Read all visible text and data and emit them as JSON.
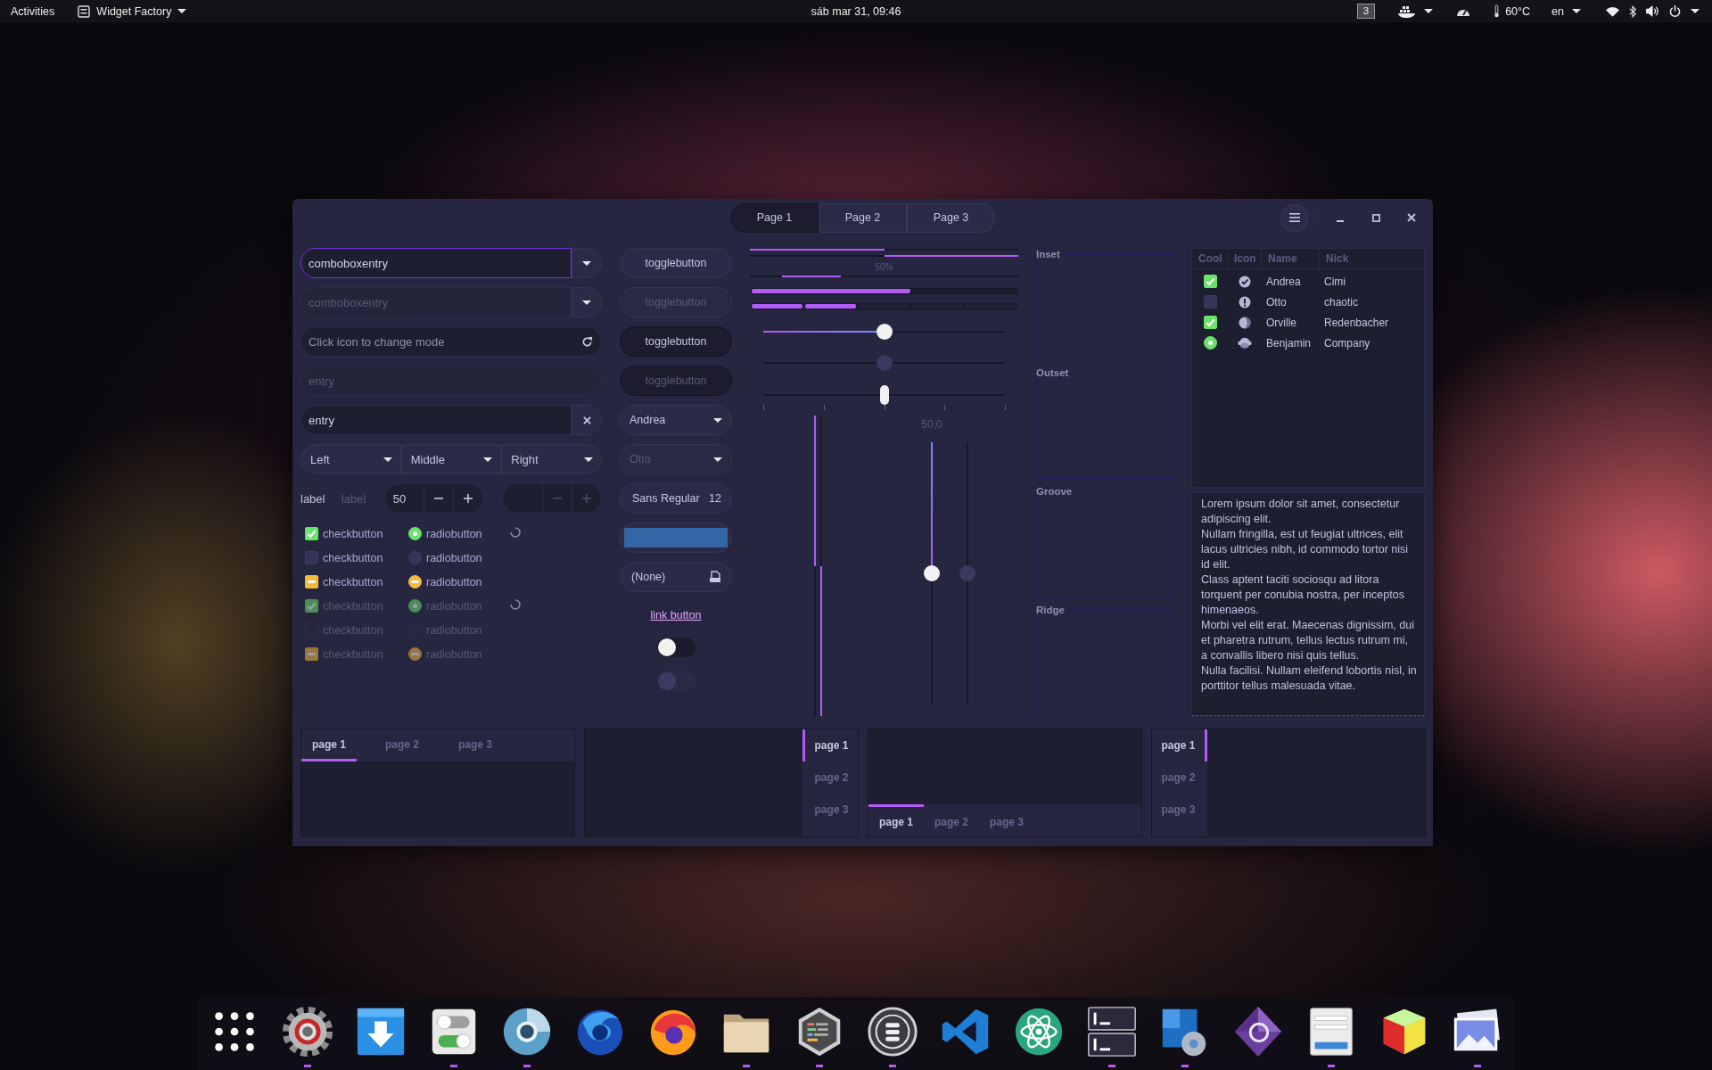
{
  "top_bar": {
    "activities": "Activities",
    "app_menu": "Widget Factory",
    "clock": "sáb mar 31, 09:46",
    "workspace": "3",
    "temperature": "60°C",
    "keyboard": "en"
  },
  "window": {
    "tabs": [
      {
        "label": "Page 1",
        "selected": true
      },
      {
        "label": "Page 2",
        "selected": false
      },
      {
        "label": "Page 3",
        "selected": false
      }
    ]
  },
  "entries": [
    {
      "kind": "combo",
      "value": "comboboxentry",
      "focused": true,
      "disabled": false
    },
    {
      "kind": "combo",
      "value": "comboboxentry",
      "focused": false,
      "disabled": true
    },
    {
      "kind": "mode",
      "placeholder": "Click icon to change mode"
    },
    {
      "kind": "plain",
      "value": "entry",
      "disabled": true
    },
    {
      "kind": "clear",
      "value": "entry",
      "disabled": false
    }
  ],
  "linked_combos": [
    "Left",
    "Middle",
    "Right"
  ],
  "labels": [
    {
      "text": "label",
      "disabled": false
    },
    {
      "text": "label",
      "disabled": true
    }
  ],
  "spin_buttons": [
    {
      "value": "50",
      "disabled": false
    },
    {
      "disabled": true
    }
  ],
  "check_rows": [
    {
      "check": {
        "label": "checkbutton",
        "checked": true,
        "disabled": false
      },
      "radio": {
        "label": "radiobutton",
        "checked": true,
        "disabled": false
      },
      "spinner": true
    },
    {
      "check": {
        "label": "checkbutton",
        "checked": false,
        "disabled": false
      },
      "radio": {
        "label": "radiobutton",
        "checked": false,
        "disabled": false
      },
      "spinner": false
    },
    {
      "check": {
        "label": "checkbutton",
        "inconsistent": true,
        "disabled": false
      },
      "radio": {
        "label": "radiobutton",
        "inconsistent": true,
        "disabled": false
      },
      "spinner": false
    },
    {
      "check": {
        "label": "checkbutton",
        "checked": true,
        "disabled": true
      },
      "radio": {
        "label": "radiobutton",
        "checked": true,
        "disabled": true
      },
      "spinner": true
    },
    {
      "check": {
        "label": "checkbutton",
        "checked": false,
        "disabled": true
      },
      "radio": {
        "label": "radiobutton",
        "checked": false,
        "disabled": true
      },
      "spinner": false
    },
    {
      "check": {
        "label": "checkbutton",
        "inconsistent": true,
        "disabled": true
      },
      "radio": {
        "label": "radiobutton",
        "inconsistent": true,
        "disabled": true
      },
      "spinner": false
    }
  ],
  "toggle_buttons": [
    {
      "label": "togglebutton",
      "active": false,
      "disabled": false
    },
    {
      "label": "togglebutton",
      "active": false,
      "disabled": true
    },
    {
      "label": "togglebutton",
      "active": true,
      "disabled": false
    },
    {
      "label": "togglebutton",
      "active": true,
      "disabled": true
    }
  ],
  "combo_boxes": [
    {
      "value": "Andrea",
      "disabled": false
    },
    {
      "value": "Otto",
      "disabled": true
    }
  ],
  "font_button": {
    "family": "Sans Regular",
    "size": "12"
  },
  "color_button": {
    "color": "#3465a4"
  },
  "file_chooser": {
    "label": "(None)"
  },
  "link_button": {
    "label": "link button"
  },
  "switches": [
    {
      "on": false,
      "disabled": false
    },
    {
      "on": false,
      "disabled": true
    }
  ],
  "progress": {
    "bars": [
      {
        "level": 0.5,
        "inverted": false
      },
      {
        "level": 0.5,
        "inverted": true
      }
    ],
    "pulse": {
      "text": "50%",
      "level": 0.22
    },
    "level_bars": [
      {
        "kind": "continuous",
        "level": 0.6
      },
      {
        "kind": "discrete",
        "level": 0.4
      }
    ]
  },
  "scales": [
    {
      "kind": "fill",
      "level": 0.5,
      "disabled": false
    },
    {
      "kind": "fill",
      "level": 0.5,
      "disabled": true
    },
    {
      "kind": "marks",
      "level": 0.5,
      "disabled": false
    }
  ],
  "vertical_bars": [
    {
      "level": 0.5,
      "inverted": false
    },
    {
      "level": 0.5,
      "inverted": true
    }
  ],
  "vertical_scales": [
    {
      "level": 0.5,
      "value": "50,0",
      "disabled": false
    },
    {
      "level": 0.5,
      "disabled": true
    }
  ],
  "frames": [
    "Inset",
    "Outset",
    "Groove",
    "Ridge"
  ],
  "tree": {
    "columns": [
      "Cool",
      "Icon",
      "Name",
      "Nick"
    ],
    "rows": [
      {
        "cool": {
          "kind": "check",
          "checked": true
        },
        "name": "Andrea",
        "nick": "Cimi"
      },
      {
        "cool": {
          "kind": "check",
          "checked": false
        },
        "name": "Otto",
        "nick": "chaotic"
      },
      {
        "cool": {
          "kind": "check",
          "checked": true
        },
        "name": "Orville",
        "nick": "Redenbacher"
      },
      {
        "cool": {
          "kind": "radio",
          "checked": true
        },
        "name": "Benjamin",
        "nick": "Company"
      }
    ]
  },
  "text_view": [
    "Lorem ipsum dolor sit amet, consectetur adipiscing elit.",
    "Nullam fringilla, est ut feugiat ultrices, elit lacus ultricies nibh, id commodo tortor nisi id elit.",
    "Class aptent taciti sociosqu ad litora torquent per conubia nostra, per inceptos himenaeos.",
    "Morbi vel elit erat. Maecenas dignissim, dui et pharetra rutrum, tellus lectus rutrum mi, a convallis libero nisi quis tellus.",
    "Nulla facilisi. Nullam eleifend lobortis nisl, in porttitor tellus malesuada vitae."
  ],
  "notebooks": [
    {
      "kind": "top",
      "tabs": [
        {
          "label": "page 1",
          "selected": true
        },
        {
          "label": "page 2",
          "selected": false
        },
        {
          "label": "page 3",
          "selected": false
        }
      ]
    },
    {
      "kind": "right",
      "tabs": [
        {
          "label": "page 1",
          "selected": true
        },
        {
          "label": "page 2",
          "selected": false
        },
        {
          "label": "page 3",
          "selected": false
        }
      ]
    },
    {
      "kind": "bottom",
      "tabs": [
        {
          "label": "page 1",
          "selected": true
        },
        {
          "label": "page 2",
          "selected": false
        },
        {
          "label": "page 3",
          "selected": false
        }
      ]
    },
    {
      "kind": "left",
      "tabs": [
        {
          "label": "page 1",
          "selected": true
        },
        {
          "label": "page 2",
          "selected": false
        },
        {
          "label": "page 3",
          "selected": false
        }
      ]
    }
  ],
  "dock": {
    "items": [
      {
        "running": true
      },
      {
        "running": false
      },
      {
        "running": true
      },
      {
        "running": true
      },
      {
        "running": false
      },
      {
        "running": false
      },
      {
        "running": true
      },
      {
        "running": true
      },
      {
        "running": true
      },
      {
        "running": false
      },
      {
        "running": false
      },
      {
        "running": true
      },
      {
        "running": true
      },
      {
        "running": false
      },
      {
        "running": true
      },
      {
        "running": false
      },
      {
        "running": true
      }
    ]
  }
}
